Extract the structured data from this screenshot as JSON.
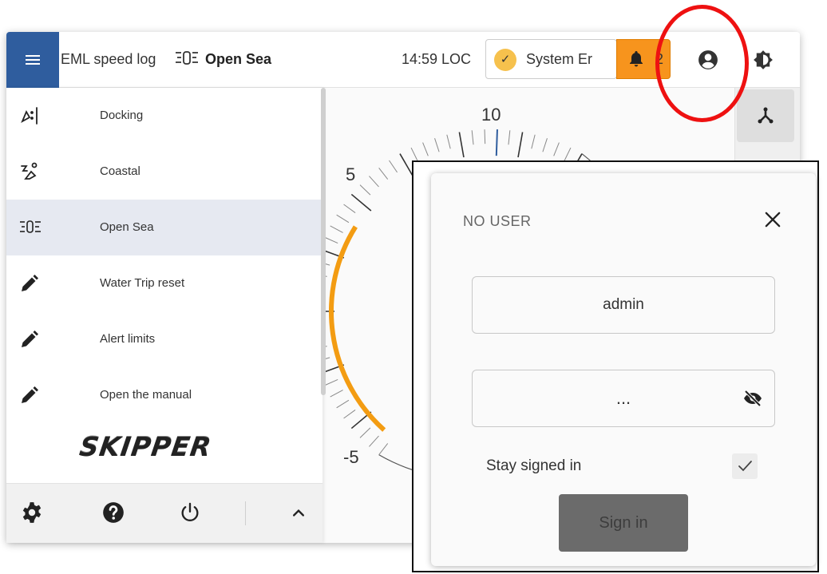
{
  "topbar": {
    "app_title": "EML speed log",
    "mode_glyph": "⃨0⃨",
    "mode_name": "Open Sea",
    "clock": "14:59 LOC",
    "status_text": "System Er",
    "alarm_count": "2"
  },
  "dial": {
    "labels": [
      "10",
      "5",
      "-5"
    ],
    "needle_value": 10,
    "arc_color": "#f39c12"
  },
  "side_menu": {
    "items": [
      {
        "icon": "docking-icon",
        "glyph": "∕⁚|",
        "label": "Docking"
      },
      {
        "icon": "coastal-icon",
        "glyph": "⸗°",
        "label": "Coastal"
      },
      {
        "icon": "open-sea-icon",
        "glyph": "≡0≡",
        "label": "Open Sea"
      },
      {
        "icon": "pencil-icon",
        "glyph": "",
        "label": "Water Trip reset"
      },
      {
        "icon": "pencil-icon",
        "glyph": "",
        "label": "Alert limits"
      },
      {
        "icon": "pencil-icon",
        "glyph": "",
        "label": "Open the manual"
      }
    ],
    "selected_index": 2,
    "logo": "SKIPPER"
  },
  "login": {
    "title": "NO USER",
    "username_value": "admin",
    "password_value": "...",
    "stay_signed_in_label": "Stay signed in",
    "stay_signed_in_checked": true,
    "signin_label": "Sign in"
  },
  "colors": {
    "menu_button": "#2f5d9e",
    "alarm": "#f7941d",
    "status_ok": "#f6c14d",
    "highlight_ring": "#ee1111",
    "selected_row": "#e6e9f1"
  }
}
